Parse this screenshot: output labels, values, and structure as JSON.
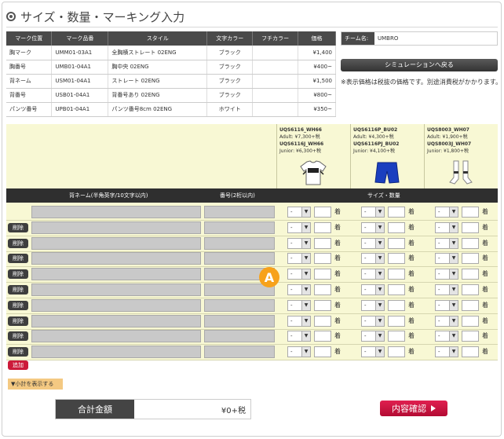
{
  "title": "サイズ・数量・マーキング入力",
  "mark_table": {
    "headers": [
      "マーク位置",
      "マーク品番",
      "スタイル",
      "文字カラー",
      "フチカラー",
      "価格"
    ],
    "rows": [
      [
        "胸マーク",
        "UMM01-03A1",
        "全胸横ストレート 02ENG",
        "ブラック",
        "",
        "¥1,400"
      ],
      [
        "胸番号",
        "UMB01-04A1",
        "胸中央 02ENG",
        "ブラック",
        "",
        "¥400~"
      ],
      [
        "背ネーム",
        "USM01-04A1",
        "ストレート 02ENG",
        "ブラック",
        "",
        "¥1,500"
      ],
      [
        "背番号",
        "USB01-04A1",
        "背番号あり 02ENG",
        "ブラック",
        "",
        "¥800~"
      ],
      [
        "パンツ番号",
        "UPB01-04A1",
        "パンツ番号8cm 02ENG",
        "ホワイト",
        "",
        "¥350~"
      ]
    ]
  },
  "team": {
    "label": "チーム名:",
    "value": "UMBRO"
  },
  "sim_button": "シミュレーションへ戻る",
  "tax_note": "※表示価格は税抜の価格です。別途消費税がかかります。",
  "products": [
    {
      "code": "UQS6116_WH66",
      "adult": "Adult: ¥7,300+税",
      "junior_code": "UQS6116J_WH66",
      "junior": "Junior: ¥6,300+税",
      "icon": "jersey-icon"
    },
    {
      "code": "UQS6116P_BU02",
      "adult": "Adult: ¥4,300+税",
      "junior_code": "UQS6116PJ_BU02",
      "junior": "Junior: ¥4,100+税",
      "icon": "shorts-icon"
    },
    {
      "code": "UQS8003_WH07",
      "adult": "Adult: ¥1,900+税",
      "junior_code": "UQS8003J_WH07",
      "junior": "Junior: ¥1,800+税",
      "icon": "socks-icon"
    }
  ],
  "columns": {
    "name": "背ネーム(半角英字/10文字以内)",
    "number": "番号(2桁以内)",
    "size_qty": "サイズ・数量"
  },
  "rows": {
    "delete_label": "削除",
    "select_value": "-",
    "unit": "着",
    "count": 10
  },
  "add_label": "追加",
  "subtotal_label": "▼小計を表示する",
  "total": {
    "label": "合計金額",
    "value": "¥0+税"
  },
  "confirm_label": "内容確認",
  "marker_label": "A"
}
